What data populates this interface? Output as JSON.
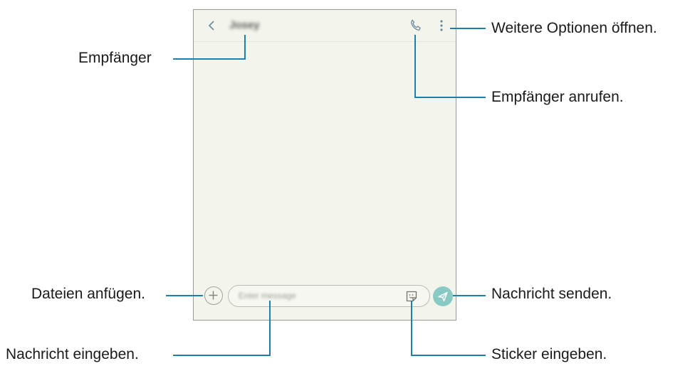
{
  "conversation": {
    "contact_name": "Josey",
    "message_placeholder": "Enter message"
  },
  "annotations": {
    "recipient": "Empfänger",
    "more_options": "Weitere Optionen öffnen.",
    "call_recipient": "Empfänger anrufen.",
    "attach_files": "Dateien anfügen.",
    "send_message": "Nachricht senden.",
    "enter_message": "Nachricht eingeben.",
    "enter_sticker": "Sticker eingeben."
  },
  "icons": {
    "back": "chevron-left-icon",
    "call": "phone-icon",
    "more": "more-vertical-icon",
    "attach": "plus-icon",
    "sticker": "sticker-icon",
    "send": "send-icon"
  },
  "colors": {
    "callout_line": "#1d7fae",
    "screen_background": "#f3f4ec",
    "icon_accent": "#6a8a9c",
    "send_button": "#88c9c4"
  }
}
